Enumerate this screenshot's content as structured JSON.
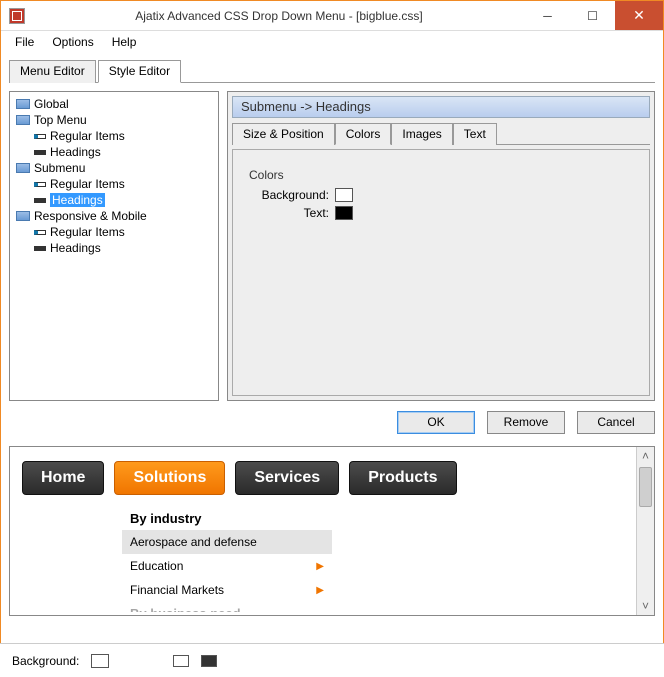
{
  "window": {
    "title": "Ajatix Advanced CSS Drop Down Menu - [bigblue.css]"
  },
  "menubar": {
    "file": "File",
    "options": "Options",
    "help": "Help"
  },
  "topTabs": {
    "menuEditor": "Menu Editor",
    "styleEditor": "Style Editor"
  },
  "tree": {
    "global": "Global",
    "topMenu": "Top Menu",
    "topRegular": "Regular Items",
    "topHeadings": "Headings",
    "submenu": "Submenu",
    "subRegular": "Regular Items",
    "subHeadings": "Headings",
    "responsive": "Responsive & Mobile",
    "respRegular": "Regular Items",
    "respHeadings": "Headings"
  },
  "pane": {
    "title": "Submenu -> Headings",
    "tabs": {
      "size": "Size & Position",
      "colors": "Colors",
      "images": "Images",
      "text": "Text"
    },
    "colorsGroup": "Colors",
    "bgLabel": "Background:",
    "textLabel": "Text:"
  },
  "buttons": {
    "ok": "OK",
    "remove": "Remove",
    "cancel": "Cancel"
  },
  "preview": {
    "nav": {
      "home": "Home",
      "solutions": "Solutions",
      "services": "Services",
      "products": "Products"
    },
    "heading1": "By industry",
    "items": {
      "aero": "Aerospace and defense",
      "edu": "Education",
      "fin": "Financial Markets"
    },
    "heading2cut": "By business need"
  },
  "footer": {
    "bg": "Background:"
  }
}
